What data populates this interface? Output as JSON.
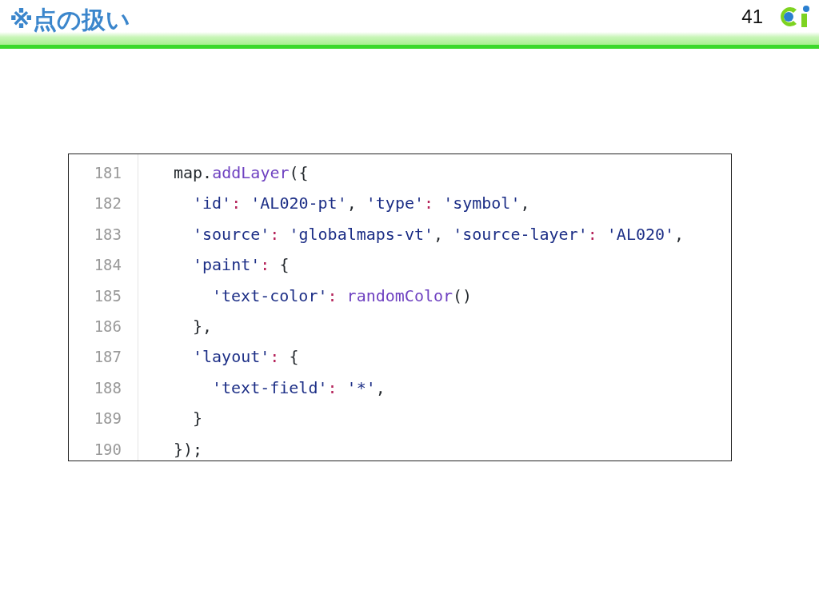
{
  "slide": {
    "title": "※点の扱い",
    "page_number": "41"
  },
  "code": {
    "lines": [
      {
        "number": "181",
        "tokens": [
          {
            "kind": "plain",
            "text": "map."
          },
          {
            "kind": "function",
            "text": "addLayer"
          },
          {
            "kind": "plain",
            "text": "({"
          }
        ],
        "children": [
          {
            "number": "182",
            "tokens": [
              {
                "kind": "string",
                "text": "'id'"
              },
              {
                "kind": "colon",
                "text": ": "
              },
              {
                "kind": "string",
                "text": "'AL020-pt'"
              },
              {
                "kind": "plain",
                "text": ", "
              },
              {
                "kind": "string",
                "text": "'type'"
              },
              {
                "kind": "colon",
                "text": ": "
              },
              {
                "kind": "string",
                "text": "'symbol'"
              },
              {
                "kind": "plain",
                "text": ","
              }
            ]
          },
          {
            "number": "183",
            "tokens": [
              {
                "kind": "string",
                "text": "'source'"
              },
              {
                "kind": "colon",
                "text": ": "
              },
              {
                "kind": "string",
                "text": "'globalmaps-vt'"
              },
              {
                "kind": "plain",
                "text": ", "
              },
              {
                "kind": "string",
                "text": "'source-layer'"
              },
              {
                "kind": "colon",
                "text": ": "
              },
              {
                "kind": "string",
                "text": "'AL020'"
              },
              {
                "kind": "plain",
                "text": ","
              }
            ]
          },
          {
            "number": "184",
            "tokens": [
              {
                "kind": "string",
                "text": "'paint'"
              },
              {
                "kind": "colon",
                "text": ": "
              },
              {
                "kind": "plain",
                "text": "{"
              }
            ],
            "children": [
              {
                "number": "185",
                "tokens": [
                  {
                    "kind": "string",
                    "text": "'text-color'"
                  },
                  {
                    "kind": "colon",
                    "text": ": "
                  },
                  {
                    "kind": "function",
                    "text": "randomColor"
                  },
                  {
                    "kind": "plain",
                    "text": "()"
                  }
                ]
              }
            ]
          },
          {
            "number": "186",
            "tokens": [
              {
                "kind": "plain",
                "text": "},"
              }
            ]
          },
          {
            "number": "187",
            "tokens": [
              {
                "kind": "string",
                "text": "'layout'"
              },
              {
                "kind": "colon",
                "text": ": "
              },
              {
                "kind": "plain",
                "text": "{"
              }
            ],
            "children": [
              {
                "number": "188",
                "tokens": [
                  {
                    "kind": "string",
                    "text": "'text-field'"
                  },
                  {
                    "kind": "colon",
                    "text": ": "
                  },
                  {
                    "kind": "string",
                    "text": "'*'"
                  },
                  {
                    "kind": "plain",
                    "text": ","
                  }
                ]
              }
            ]
          },
          {
            "number": "189",
            "tokens": [
              {
                "kind": "plain",
                "text": "}"
              }
            ]
          }
        ]
      },
      {
        "number": "190",
        "tokens": [
          {
            "kind": "plain",
            "text": "});"
          }
        ]
      }
    ]
  }
}
